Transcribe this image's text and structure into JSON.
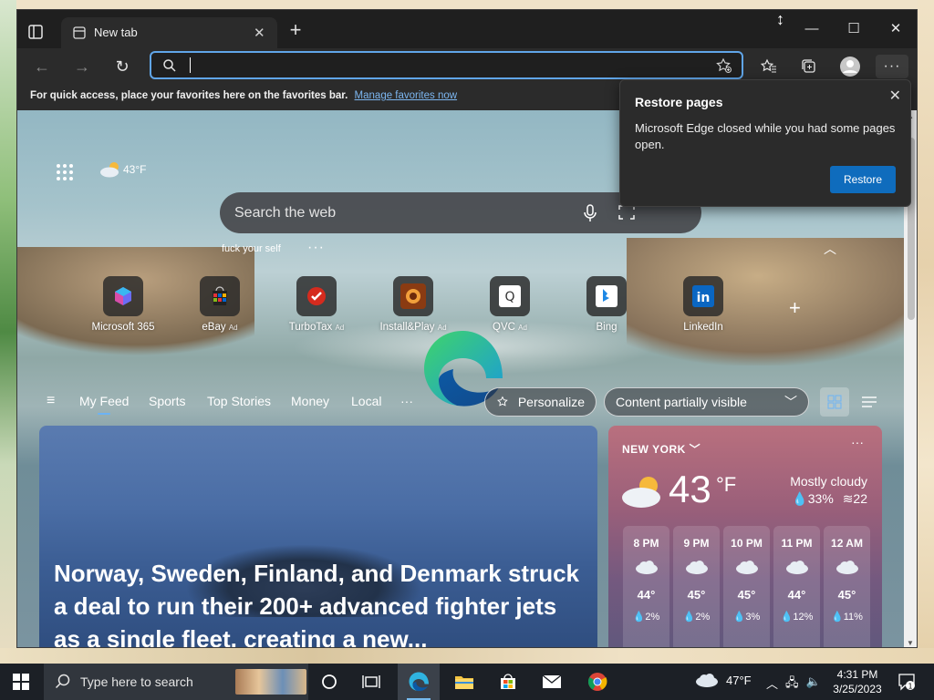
{
  "browser": {
    "tab_title": "New tab",
    "address_value": "",
    "favbar_text": "For quick access, place your favorites here on the favorites bar.",
    "favbar_link": "Manage favorites now"
  },
  "newtab": {
    "weather_temp": "43°F",
    "search_placeholder": "Search the web",
    "recent_search": "fuck your self",
    "tiles": [
      {
        "label": "Microsoft 365",
        "ad": ""
      },
      {
        "label": "eBay",
        "ad": "Ad"
      },
      {
        "label": "TurboTax",
        "ad": "Ad"
      },
      {
        "label": "Install&Play",
        "ad": "Ad"
      },
      {
        "label": "QVC",
        "ad": "Ad"
      },
      {
        "label": "Bing",
        "ad": ""
      },
      {
        "label": "LinkedIn",
        "ad": ""
      }
    ],
    "feed_tabs": [
      "My Feed",
      "Sports",
      "Top Stories",
      "Money",
      "Local"
    ],
    "personalize": "Personalize",
    "content_visibility": "Content partially visible"
  },
  "news": {
    "headline": "Norway, Sweden, Finland, and Denmark struck a deal to run their 200+ advanced fighter jets as a single fleet, creating a new..."
  },
  "weather_card": {
    "city": "NEW YORK",
    "temp": "43",
    "unit": "°F",
    "condition": "Mostly cloudy",
    "humidity": "33%",
    "wind": "22",
    "hourly": [
      {
        "time": "8 PM",
        "temp": "44°",
        "precip": "2%"
      },
      {
        "time": "9 PM",
        "temp": "45°",
        "precip": "2%"
      },
      {
        "time": "10 PM",
        "temp": "45°",
        "precip": "3%"
      },
      {
        "time": "11 PM",
        "temp": "44°",
        "precip": "12%"
      },
      {
        "time": "12 AM",
        "temp": "45°",
        "precip": "11%"
      }
    ]
  },
  "popup": {
    "title": "Restore pages",
    "message": "Microsoft Edge closed while you had some pages open.",
    "button": "Restore"
  },
  "taskbar": {
    "search_placeholder": "Type here to search",
    "weather": "47°F",
    "time": "4:31 PM",
    "date": "3/25/2023",
    "notification_count": "1"
  },
  "colors": {
    "accent": "#0f6cbd",
    "link": "#7cb6f0",
    "address_focus": "#60a5e8"
  }
}
